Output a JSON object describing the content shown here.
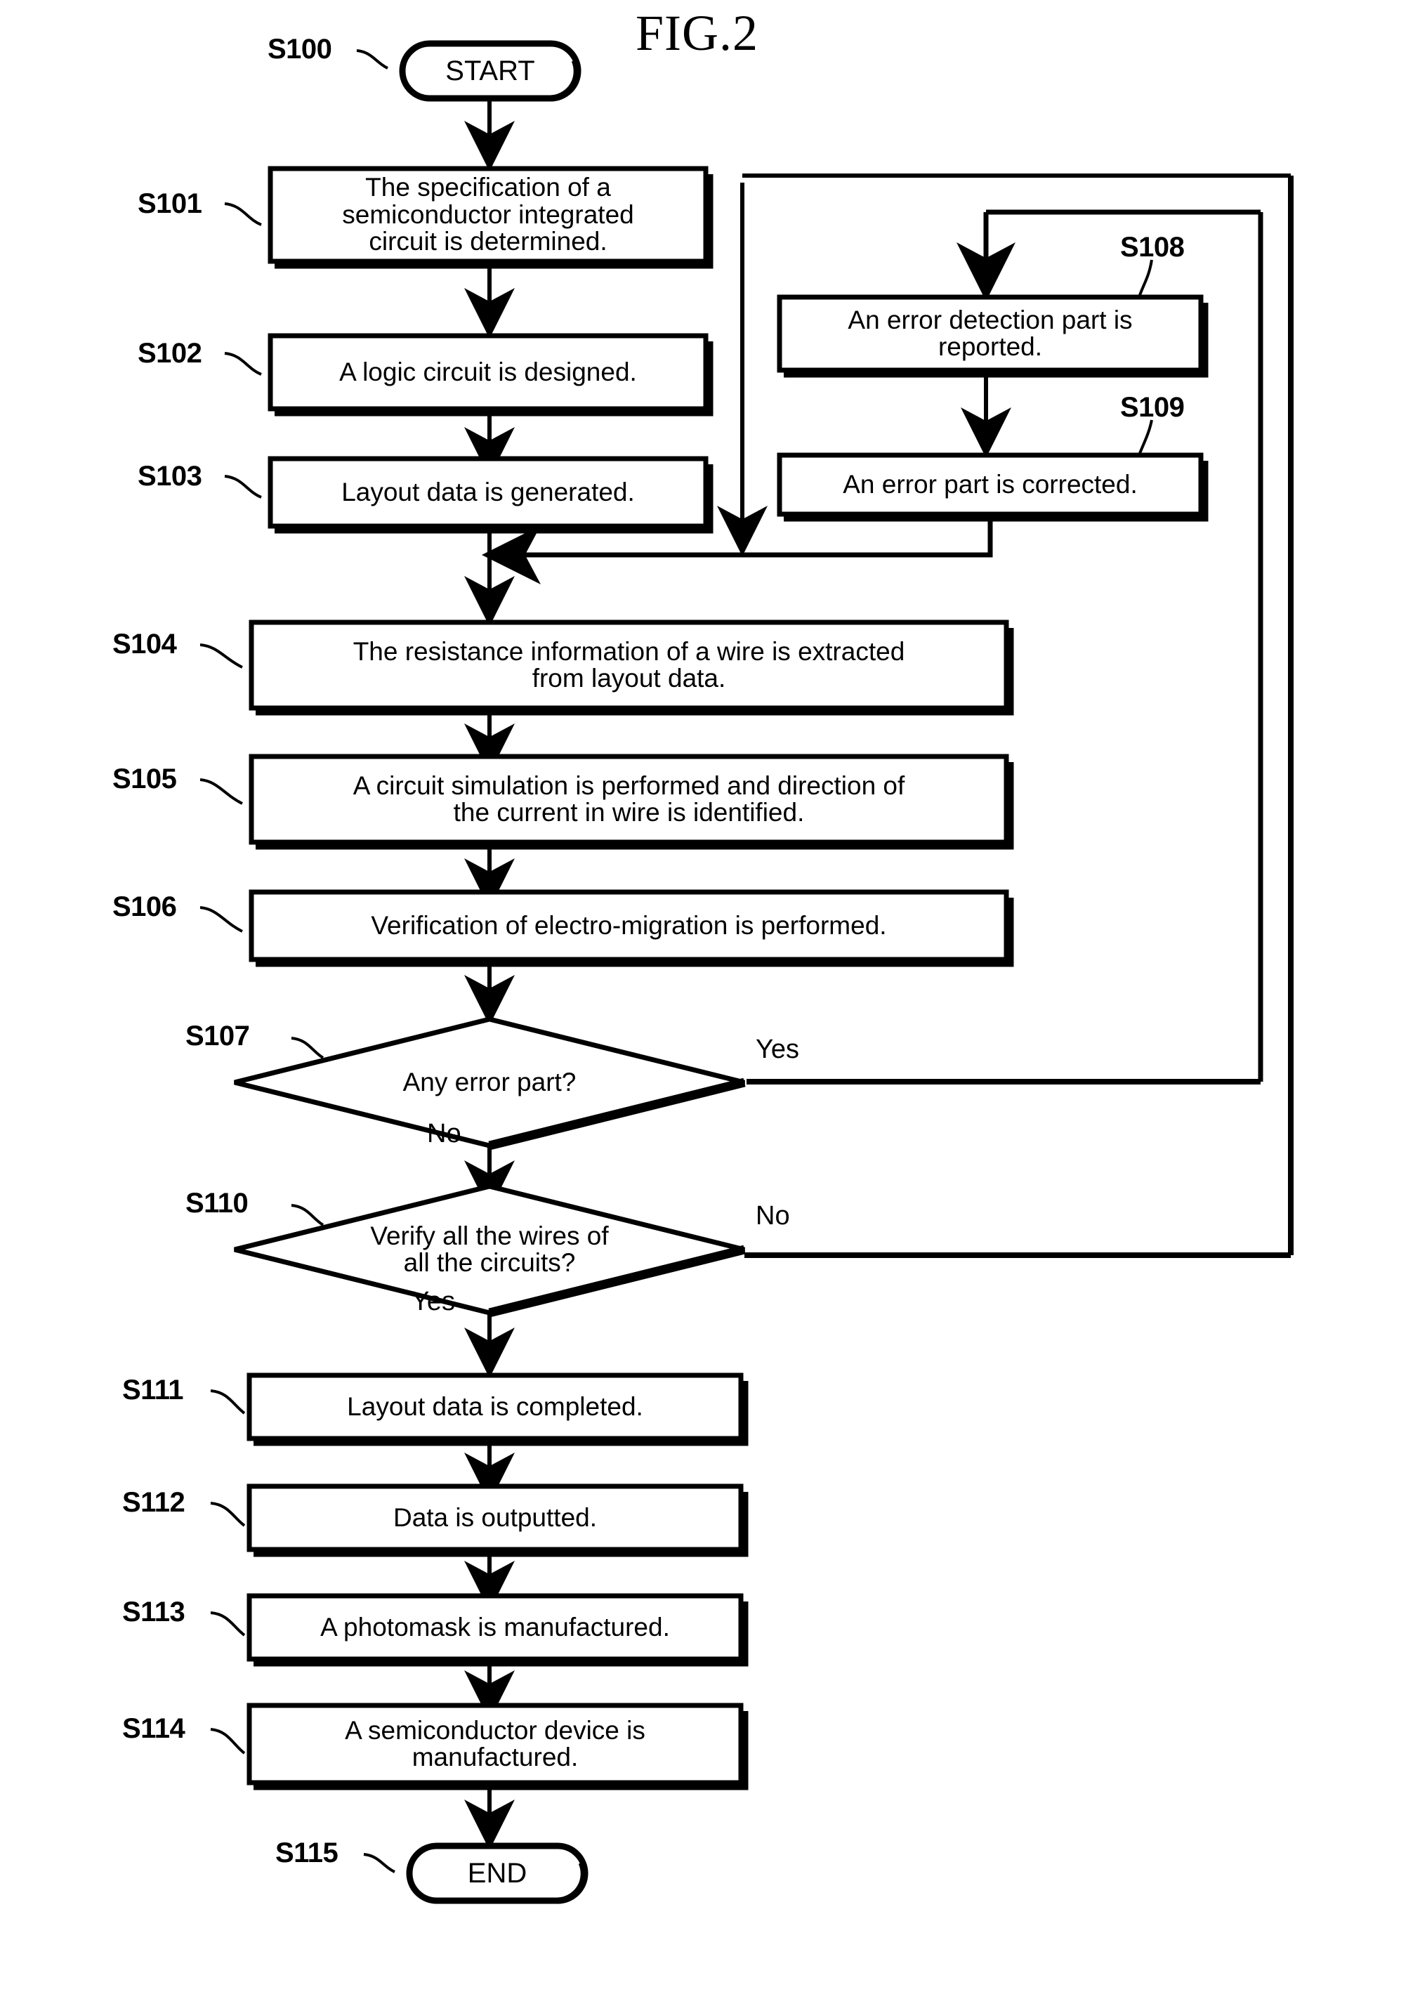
{
  "figure": {
    "title": "FIG.2",
    "type": "flowchart",
    "description": "Semiconductor integrated circuit design and electro-migration verification flow"
  },
  "nodes": [
    {
      "id": "S100",
      "ref_label": "S100",
      "shape": "terminator",
      "text": "START",
      "lines": [
        "START"
      ]
    },
    {
      "id": "S101",
      "ref_label": "S101",
      "shape": "process",
      "text": "The specification of a semiconductor integrated circuit is determined.",
      "lines": [
        "The specification of a",
        "semiconductor integrated",
        "circuit is determined."
      ]
    },
    {
      "id": "S102",
      "ref_label": "S102",
      "shape": "process",
      "text": "A  logic circuit is designed.",
      "lines": [
        "A  logic circuit is designed."
      ]
    },
    {
      "id": "S103",
      "ref_label": "S103",
      "shape": "process",
      "text": "Layout data is generated.",
      "lines": [
        "Layout data is generated."
      ]
    },
    {
      "id": "S104",
      "ref_label": "S104",
      "shape": "process",
      "text": "The resistance information of a wire is extracted from layout data.",
      "lines": [
        "The resistance information of a wire is extracted",
        "from layout data."
      ]
    },
    {
      "id": "S105",
      "ref_label": "S105",
      "shape": "process",
      "text": "A circuit simulation is performed and direction of the current in wire is identified.",
      "lines": [
        "A circuit simulation is performed and direction of",
        "the current in wire is identified."
      ]
    },
    {
      "id": "S106",
      "ref_label": "S106",
      "shape": "process",
      "text": "Verification of electro-migration is performed.",
      "lines": [
        "Verification of electro-migration is performed."
      ]
    },
    {
      "id": "S107",
      "ref_label": "S107",
      "shape": "decision",
      "text": "Any error part?",
      "lines": [
        "Any error part?"
      ],
      "branches": {
        "right": "Yes",
        "down": "No"
      }
    },
    {
      "id": "S108",
      "ref_label": "S108",
      "shape": "process",
      "text": "An error detection part is reported.",
      "lines": [
        "An error detection part is",
        "reported."
      ]
    },
    {
      "id": "S109",
      "ref_label": "S109",
      "shape": "process",
      "text": "An error part is corrected.",
      "lines": [
        "An error part is corrected."
      ]
    },
    {
      "id": "S110",
      "ref_label": "S110",
      "shape": "decision",
      "text": "Verify all the wires of all the circuits?",
      "lines": [
        "Verify all the wires of",
        "all the circuits?"
      ],
      "branches": {
        "right": "No",
        "down": "Yes"
      }
    },
    {
      "id": "S111",
      "ref_label": "S111",
      "shape": "process",
      "text": "Layout data is completed.",
      "lines": [
        "Layout data is completed."
      ]
    },
    {
      "id": "S112",
      "ref_label": "S112",
      "shape": "process",
      "text": "Data is outputted.",
      "lines": [
        "Data is outputted."
      ]
    },
    {
      "id": "S113",
      "ref_label": "S113",
      "shape": "process",
      "text": "A photomask is manufactured.",
      "lines": [
        "A photomask is manufactured."
      ]
    },
    {
      "id": "S114",
      "ref_label": "S114",
      "shape": "process",
      "text": "A semiconductor device is manufactured.",
      "lines": [
        "A semiconductor device is",
        "manufactured."
      ]
    },
    {
      "id": "S115",
      "ref_label": "S115",
      "shape": "terminator",
      "text": "END",
      "lines": [
        "END"
      ]
    }
  ],
  "branch_labels": {
    "s107_yes": "Yes",
    "s107_no": "No",
    "s110_no": "No",
    "s110_yes": "Yes"
  },
  "colors": {
    "stroke": "#000000",
    "fill": "#ffffff",
    "text": "#000000"
  }
}
